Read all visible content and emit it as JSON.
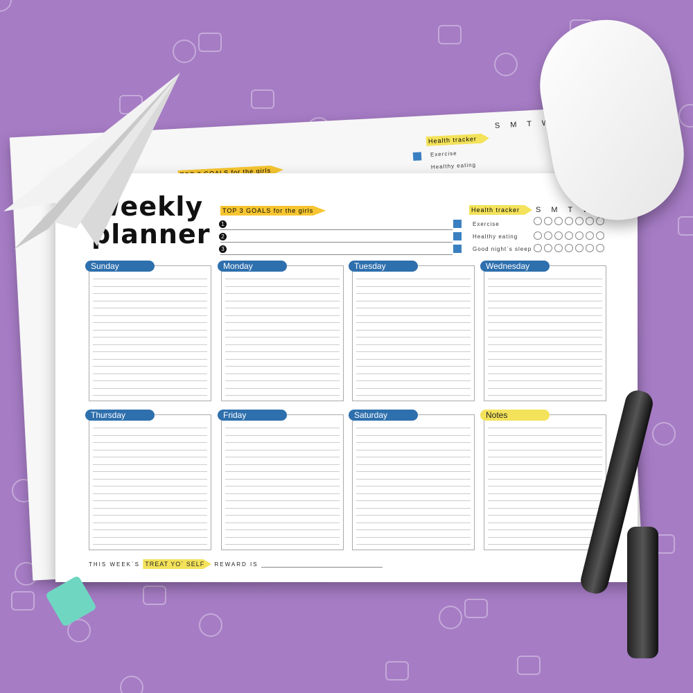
{
  "colors": {
    "background": "#a67cc5",
    "day_pill": "#2e6fad",
    "notes_pill": "#f3e25a",
    "goals_highlight": "#f6c531",
    "checkbox": "#3a80c0"
  },
  "back_sheet": {
    "goals_label": "TOP 3 GOALS for the girls",
    "tracker_label": "Health tracker",
    "days": "S M T W T F",
    "habits": [
      "Exercise",
      "Healthy eating"
    ]
  },
  "planner": {
    "title": "Weekly planner",
    "goals_label": "TOP 3 GOALS for the girls",
    "goal_numbers": [
      "1",
      "2",
      "3"
    ],
    "tracker_label": "Health tracker",
    "tracker_days": "S M T W T F",
    "habits": [
      "Exercise",
      "Healthy eating",
      "Good night`s sleep"
    ],
    "sections": [
      "Sunday",
      "Monday",
      "Tuesday",
      "Wednesday",
      "Thursday",
      "Friday",
      "Saturday",
      "Notes"
    ],
    "footer": {
      "prefix": "THIS WEEK`S",
      "highlight": "TREAT YO` SELF",
      "suffix": "REWARD IS"
    }
  },
  "props": [
    "paper-plane",
    "computer-mouse",
    "fountain-pen",
    "binder-clip"
  ]
}
